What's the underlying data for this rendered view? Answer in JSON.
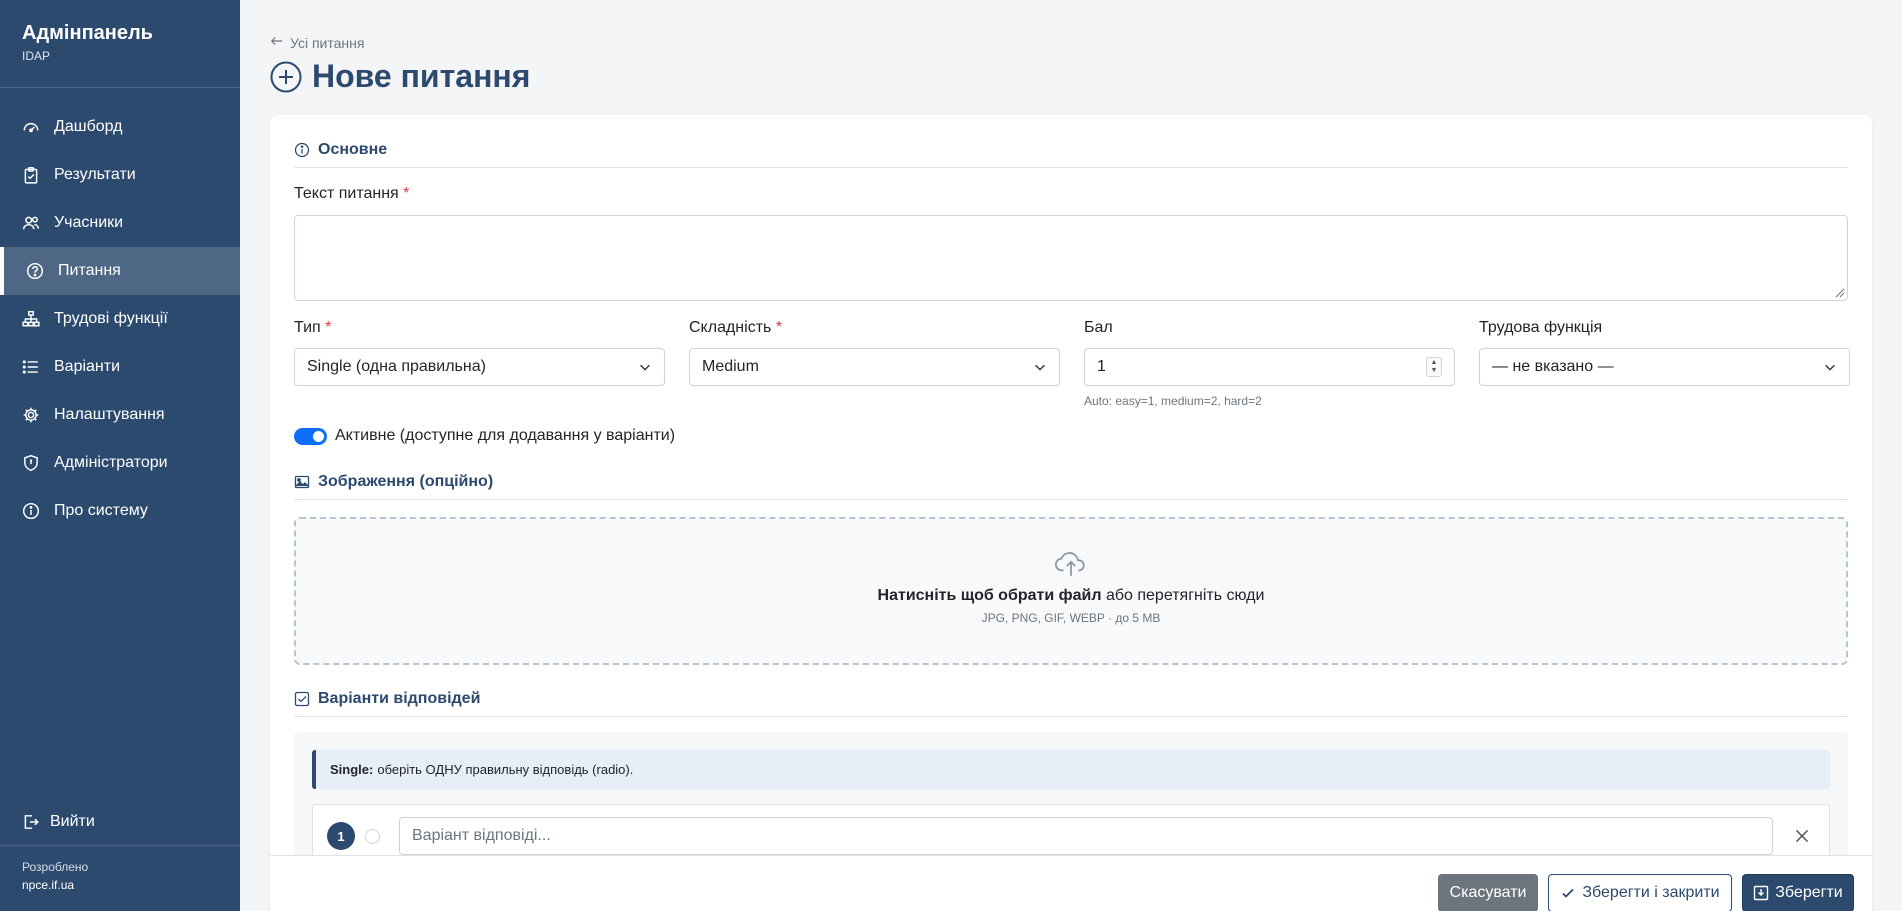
{
  "sidebar": {
    "title": "Адмінпанель",
    "subtitle": "IDAP",
    "items": [
      {
        "label": "Дашборд",
        "icon": "dashboard-icon"
      },
      {
        "label": "Результати",
        "icon": "clipboard-icon"
      },
      {
        "label": "Учасники",
        "icon": "users-icon"
      },
      {
        "label": "Питання",
        "icon": "question-icon",
        "active": true
      },
      {
        "label": "Трудові функції",
        "icon": "hierarchy-icon"
      },
      {
        "label": "Варіанти",
        "icon": "list-icon"
      },
      {
        "label": "Налаштування",
        "icon": "gear-icon"
      },
      {
        "label": "Адміністратори",
        "icon": "shield-icon"
      },
      {
        "label": "Про систему",
        "icon": "info-icon"
      }
    ],
    "logout_label": "Вийти",
    "credit_line1": "Розроблено",
    "credit_line2": "npce.if.ua"
  },
  "header": {
    "back_link": "Усі питання",
    "title": "Нове питання"
  },
  "form": {
    "section_basic": "Основне",
    "question_text_label": "Текст питання",
    "question_text_value": "",
    "type_label": "Тип",
    "type_value": "Single (одна правильна)",
    "difficulty_label": "Складність",
    "difficulty_value": "Medium",
    "score_label": "Бал",
    "score_value": "1",
    "score_hint": "Auto: easy=1, medium=2, hard=2",
    "function_label": "Трудова функція",
    "function_value": "— не вказано —",
    "required_mark": "*",
    "active_label": "Активне (доступне для додавання у варіанти)",
    "active_on": true,
    "section_image": "Зображення (опційно)",
    "upload_bold": "Натисніть щоб обрати файл",
    "upload_rest": " або перетягніть сюди",
    "upload_hint": "JPG, PNG, GIF, WEBP · до 5 MB",
    "section_answers": "Варіанти відповідей",
    "single_note_bold": "Single:",
    "single_note_text": "оберіть ОДНУ правильну відповідь (radio).",
    "answers": [
      {
        "number": "1",
        "placeholder": "Варіант відповіді..."
      }
    ]
  },
  "actions": {
    "cancel": "Скасувати",
    "save_close": "Зберегти і закрити",
    "save": "Зберегти"
  },
  "colors": {
    "sidebar_bg": "#2c4a6e",
    "accent": "#0d6efd",
    "required": "#dc3545"
  }
}
